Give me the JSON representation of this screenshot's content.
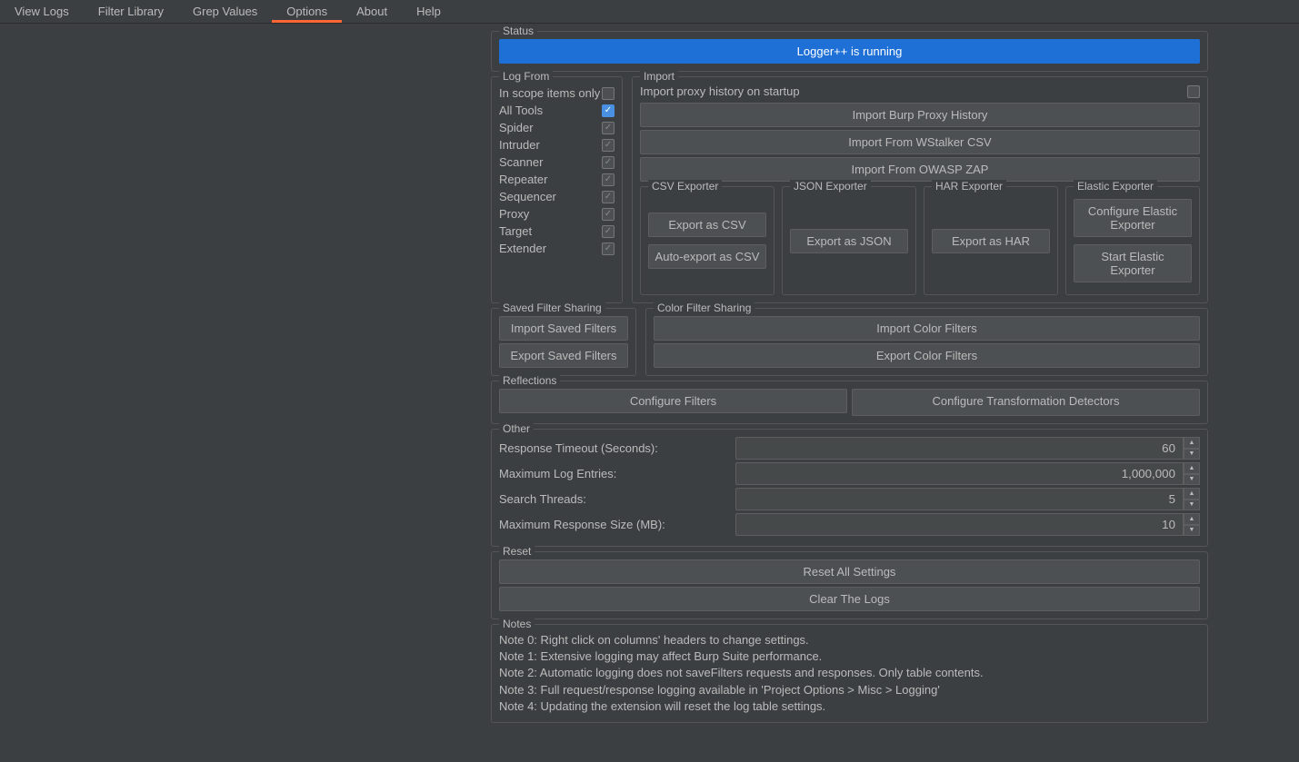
{
  "tabs": [
    "View Logs",
    "Filter Library",
    "Grep Values",
    "Options",
    "About",
    "Help"
  ],
  "activeTab": 3,
  "status": {
    "title": "Status",
    "text": "Logger++ is running"
  },
  "logFrom": {
    "title": "Log From",
    "inScopeLabel": "In scope items only",
    "tools": [
      {
        "label": "All Tools",
        "checkedBlue": true
      },
      {
        "label": "Spider",
        "checkedGrey": true
      },
      {
        "label": "Intruder",
        "checkedGrey": true
      },
      {
        "label": "Scanner",
        "checkedGrey": true
      },
      {
        "label": "Repeater",
        "checkedGrey": true
      },
      {
        "label": "Sequencer",
        "checkedGrey": true
      },
      {
        "label": "Proxy",
        "checkedGrey": true
      },
      {
        "label": "Target",
        "checkedGrey": true
      },
      {
        "label": "Extender",
        "checkedGrey": true
      }
    ]
  },
  "import": {
    "title": "Import",
    "startupLabel": "Import proxy history on startup",
    "buttons": [
      "Import Burp Proxy History",
      "Import From WStalker CSV",
      "Import From OWASP ZAP"
    ]
  },
  "exporters": {
    "csv": {
      "title": "CSV Exporter",
      "b1": "Export as CSV",
      "b2": "Auto-export as CSV"
    },
    "json": {
      "title": "JSON Exporter",
      "b1": "Export as JSON"
    },
    "har": {
      "title": "HAR Exporter",
      "b1": "Export as HAR"
    },
    "elastic": {
      "title": "Elastic Exporter",
      "b1": "Configure Elastic Exporter",
      "b2": "Start Elastic Exporter"
    }
  },
  "savedFilter": {
    "title": "Saved Filter Sharing",
    "b1": "Import Saved Filters",
    "b2": "Export Saved Filters"
  },
  "colorFilter": {
    "title": "Color Filter Sharing",
    "b1": "Import Color Filters",
    "b2": "Export Color Filters"
  },
  "reflections": {
    "title": "Reflections",
    "b1": "Configure Filters",
    "b2": "Configure Transformation Detectors"
  },
  "other": {
    "title": "Other",
    "rows": [
      {
        "label": "Response Timeout (Seconds):",
        "value": "60"
      },
      {
        "label": "Maximum Log Entries:",
        "value": "1,000,000"
      },
      {
        "label": "Search Threads:",
        "value": "5"
      },
      {
        "label": "Maximum Response Size (MB):",
        "value": "10"
      }
    ]
  },
  "reset": {
    "title": "Reset",
    "b1": "Reset All Settings",
    "b2": "Clear The Logs"
  },
  "notes": {
    "title": "Notes",
    "lines": [
      "Note 0: Right click on columns' headers to change settings.",
      "Note 1: Extensive logging  may affect Burp Suite performance.",
      "Note 2: Automatic logging does not saveFilters requests and responses. Only table contents.",
      "Note 3: Full request/response logging available in 'Project Options > Misc > Logging'",
      "Note 4: Updating the extension will reset the log table settings."
    ]
  }
}
